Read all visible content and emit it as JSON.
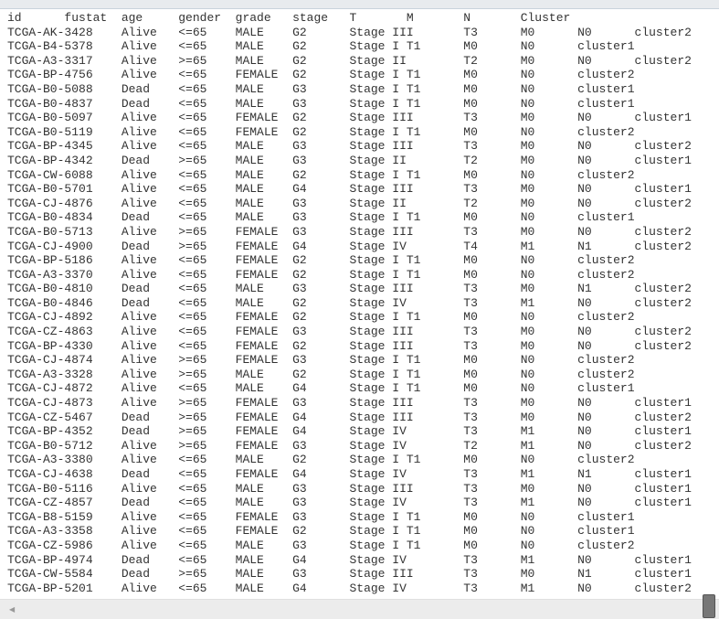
{
  "file": {
    "header": [
      "id",
      "fustat",
      "age",
      "gender",
      "grade",
      "stage",
      "T",
      "M",
      "N",
      "Cluster"
    ],
    "rows": [
      [
        "TCGA-AK-3428",
        "Alive",
        "<=65",
        "MALE",
        "G2",
        "Stage III",
        "T3",
        "M0",
        "N0",
        "cluster2"
      ],
      [
        "TCGA-B4-5378",
        "Alive",
        "<=65",
        "MALE",
        "G2",
        "Stage I",
        "T1",
        "M0",
        "N0",
        "cluster1"
      ],
      [
        "TCGA-A3-3317",
        "Alive",
        ">=65",
        "MALE",
        "G2",
        "Stage II",
        "T2",
        "M0",
        "N0",
        "cluster2"
      ],
      [
        "TCGA-BP-4756",
        "Alive",
        "<=65",
        "FEMALE",
        "G2",
        "Stage I",
        "T1",
        "M0",
        "N0",
        "cluster2"
      ],
      [
        "TCGA-B0-5088",
        "Dead",
        "<=65",
        "MALE",
        "G3",
        "Stage I",
        "T1",
        "M0",
        "N0",
        "cluster1"
      ],
      [
        "TCGA-B0-4837",
        "Dead",
        "<=65",
        "MALE",
        "G3",
        "Stage I",
        "T1",
        "M0",
        "N0",
        "cluster1"
      ],
      [
        "TCGA-B0-5097",
        "Alive",
        "<=65",
        "FEMALE",
        "G2",
        "Stage III",
        "T3",
        "M0",
        "N0",
        "cluster1"
      ],
      [
        "TCGA-B0-5119",
        "Alive",
        "<=65",
        "FEMALE",
        "G2",
        "Stage I",
        "T1",
        "M0",
        "N0",
        "cluster2"
      ],
      [
        "TCGA-BP-4345",
        "Alive",
        "<=65",
        "MALE",
        "G3",
        "Stage III",
        "T3",
        "M0",
        "N0",
        "cluster2"
      ],
      [
        "TCGA-BP-4342",
        "Dead",
        ">=65",
        "MALE",
        "G3",
        "Stage II",
        "T2",
        "M0",
        "N0",
        "cluster1"
      ],
      [
        "TCGA-CW-6088",
        "Alive",
        "<=65",
        "MALE",
        "G2",
        "Stage I",
        "T1",
        "M0",
        "N0",
        "cluster2"
      ],
      [
        "TCGA-B0-5701",
        "Alive",
        "<=65",
        "MALE",
        "G4",
        "Stage III",
        "T3",
        "M0",
        "N0",
        "cluster1"
      ],
      [
        "TCGA-CJ-4876",
        "Alive",
        "<=65",
        "MALE",
        "G3",
        "Stage II",
        "T2",
        "M0",
        "N0",
        "cluster2"
      ],
      [
        "TCGA-B0-4834",
        "Dead",
        "<=65",
        "MALE",
        "G3",
        "Stage I",
        "T1",
        "M0",
        "N0",
        "cluster1"
      ],
      [
        "TCGA-B0-5713",
        "Alive",
        ">=65",
        "FEMALE",
        "G3",
        "Stage III",
        "T3",
        "M0",
        "N0",
        "cluster2"
      ],
      [
        "TCGA-CJ-4900",
        "Dead",
        ">=65",
        "FEMALE",
        "G4",
        "Stage IV",
        "T4",
        "M1",
        "N1",
        "cluster2"
      ],
      [
        "TCGA-BP-5186",
        "Alive",
        "<=65",
        "FEMALE",
        "G2",
        "Stage I",
        "T1",
        "M0",
        "N0",
        "cluster2"
      ],
      [
        "TCGA-A3-3370",
        "Alive",
        "<=65",
        "FEMALE",
        "G2",
        "Stage I",
        "T1",
        "M0",
        "N0",
        "cluster2"
      ],
      [
        "TCGA-B0-4810",
        "Dead",
        "<=65",
        "MALE",
        "G3",
        "Stage III",
        "T3",
        "M0",
        "N1",
        "cluster2"
      ],
      [
        "TCGA-B0-4846",
        "Dead",
        "<=65",
        "MALE",
        "G2",
        "Stage IV",
        "T3",
        "M1",
        "N0",
        "cluster2"
      ],
      [
        "TCGA-CJ-4892",
        "Alive",
        "<=65",
        "FEMALE",
        "G2",
        "Stage I",
        "T1",
        "M0",
        "N0",
        "cluster2"
      ],
      [
        "TCGA-CZ-4863",
        "Alive",
        "<=65",
        "FEMALE",
        "G3",
        "Stage III",
        "T3",
        "M0",
        "N0",
        "cluster2"
      ],
      [
        "TCGA-BP-4330",
        "Alive",
        "<=65",
        "FEMALE",
        "G2",
        "Stage III",
        "T3",
        "M0",
        "N0",
        "cluster2"
      ],
      [
        "TCGA-CJ-4874",
        "Alive",
        ">=65",
        "FEMALE",
        "G3",
        "Stage I",
        "T1",
        "M0",
        "N0",
        "cluster2"
      ],
      [
        "TCGA-A3-3328",
        "Alive",
        ">=65",
        "MALE",
        "G2",
        "Stage I",
        "T1",
        "M0",
        "N0",
        "cluster2"
      ],
      [
        "TCGA-CJ-4872",
        "Alive",
        "<=65",
        "MALE",
        "G4",
        "Stage I",
        "T1",
        "M0",
        "N0",
        "cluster1"
      ],
      [
        "TCGA-CJ-4873",
        "Alive",
        ">=65",
        "FEMALE",
        "G3",
        "Stage III",
        "T3",
        "M0",
        "N0",
        "cluster1"
      ],
      [
        "TCGA-CZ-5467",
        "Dead",
        ">=65",
        "FEMALE",
        "G4",
        "Stage III",
        "T3",
        "M0",
        "N0",
        "cluster2"
      ],
      [
        "TCGA-BP-4352",
        "Dead",
        ">=65",
        "FEMALE",
        "G4",
        "Stage IV",
        "T3",
        "M1",
        "N0",
        "cluster1"
      ],
      [
        "TCGA-B0-5712",
        "Alive",
        ">=65",
        "FEMALE",
        "G3",
        "Stage IV",
        "T2",
        "M1",
        "N0",
        "cluster2"
      ],
      [
        "TCGA-A3-3380",
        "Alive",
        "<=65",
        "MALE",
        "G2",
        "Stage I",
        "T1",
        "M0",
        "N0",
        "cluster2"
      ],
      [
        "TCGA-CJ-4638",
        "Dead",
        "<=65",
        "FEMALE",
        "G4",
        "Stage IV",
        "T3",
        "M1",
        "N1",
        "cluster1"
      ],
      [
        "TCGA-B0-5116",
        "Alive",
        "<=65",
        "MALE",
        "G3",
        "Stage III",
        "T3",
        "M0",
        "N0",
        "cluster1"
      ],
      [
        "TCGA-CZ-4857",
        "Dead",
        "<=65",
        "MALE",
        "G3",
        "Stage IV",
        "T3",
        "M1",
        "N0",
        "cluster1"
      ],
      [
        "TCGA-B8-5159",
        "Alive",
        "<=65",
        "FEMALE",
        "G3",
        "Stage I",
        "T1",
        "M0",
        "N0",
        "cluster1"
      ],
      [
        "TCGA-A3-3358",
        "Alive",
        "<=65",
        "FEMALE",
        "G2",
        "Stage I",
        "T1",
        "M0",
        "N0",
        "cluster1"
      ],
      [
        "TCGA-CZ-5986",
        "Alive",
        "<=65",
        "MALE",
        "G3",
        "Stage I",
        "T1",
        "M0",
        "N0",
        "cluster2"
      ],
      [
        "TCGA-BP-4974",
        "Dead",
        "<=65",
        "MALE",
        "G4",
        "Stage IV",
        "T3",
        "M1",
        "N0",
        "cluster1"
      ],
      [
        "TCGA-CW-5584",
        "Dead",
        ">=65",
        "MALE",
        "G3",
        "Stage III",
        "T3",
        "M0",
        "N1",
        "cluster1"
      ],
      [
        "TCGA-BP-5201",
        "Alive",
        "<=65",
        "MALE",
        "G4",
        "Stage IV",
        "T3",
        "M1",
        "N0",
        "cluster2"
      ]
    ]
  },
  "scrollbar": {
    "left_arrow_icon": "triangle-left"
  }
}
